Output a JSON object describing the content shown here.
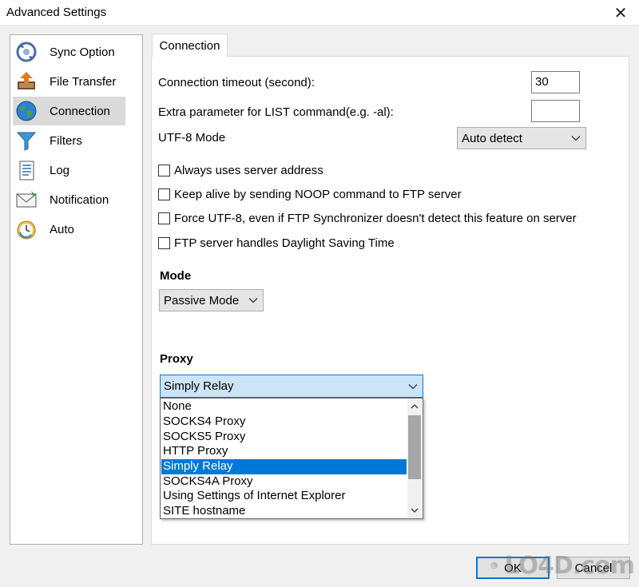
{
  "window": {
    "title": "Advanced Settings",
    "close_glyph": "✕"
  },
  "nav": {
    "items": [
      {
        "label": "Sync Option",
        "icon": "sync-icon"
      },
      {
        "label": "File Transfer",
        "icon": "file-transfer-icon"
      },
      {
        "label": "Connection",
        "icon": "globe-icon",
        "selected": true
      },
      {
        "label": "Filters",
        "icon": "funnel-icon"
      },
      {
        "label": "Log",
        "icon": "log-icon"
      },
      {
        "label": "Notification",
        "icon": "envelope-icon"
      },
      {
        "label": "Auto",
        "icon": "clock-icon"
      }
    ]
  },
  "tab": {
    "label": "Connection"
  },
  "form": {
    "timeout_label": "Connection timeout (second):",
    "timeout_value": "30",
    "extra_param_label": "Extra parameter for LIST command(e.g. -al):",
    "extra_param_value": "",
    "utf8_label": "UTF-8 Mode",
    "utf8_value": "Auto detect",
    "checkboxes": [
      {
        "label": "Always uses server address",
        "checked": false
      },
      {
        "label": "Keep alive by sending NOOP command to FTP server",
        "checked": false
      },
      {
        "label": "Force UTF-8, even if FTP Synchronizer doesn't detect this feature on server",
        "checked": false
      },
      {
        "label": "FTP server handles Daylight Saving Time",
        "checked": false
      }
    ],
    "mode_heading": "Mode",
    "mode_value": "Passive Mode",
    "proxy_heading": "Proxy",
    "proxy_value": "Simply Relay",
    "proxy_options": [
      "None",
      "SOCKS4 Proxy",
      "SOCKS5 Proxy",
      "HTTP Proxy",
      "Simply Relay",
      "SOCKS4A Proxy",
      "Using Settings of Internet Explorer",
      "SITE hostname"
    ],
    "proxy_selected_index": 4
  },
  "buttons": {
    "ok": "OK",
    "cancel": "Cancel"
  },
  "watermark": {
    "text": "LO4D.com"
  },
  "colors": {
    "accent": "#0078d7",
    "selection_bg": "#0078d7",
    "combo_focus_bg": "#cce4f7"
  }
}
